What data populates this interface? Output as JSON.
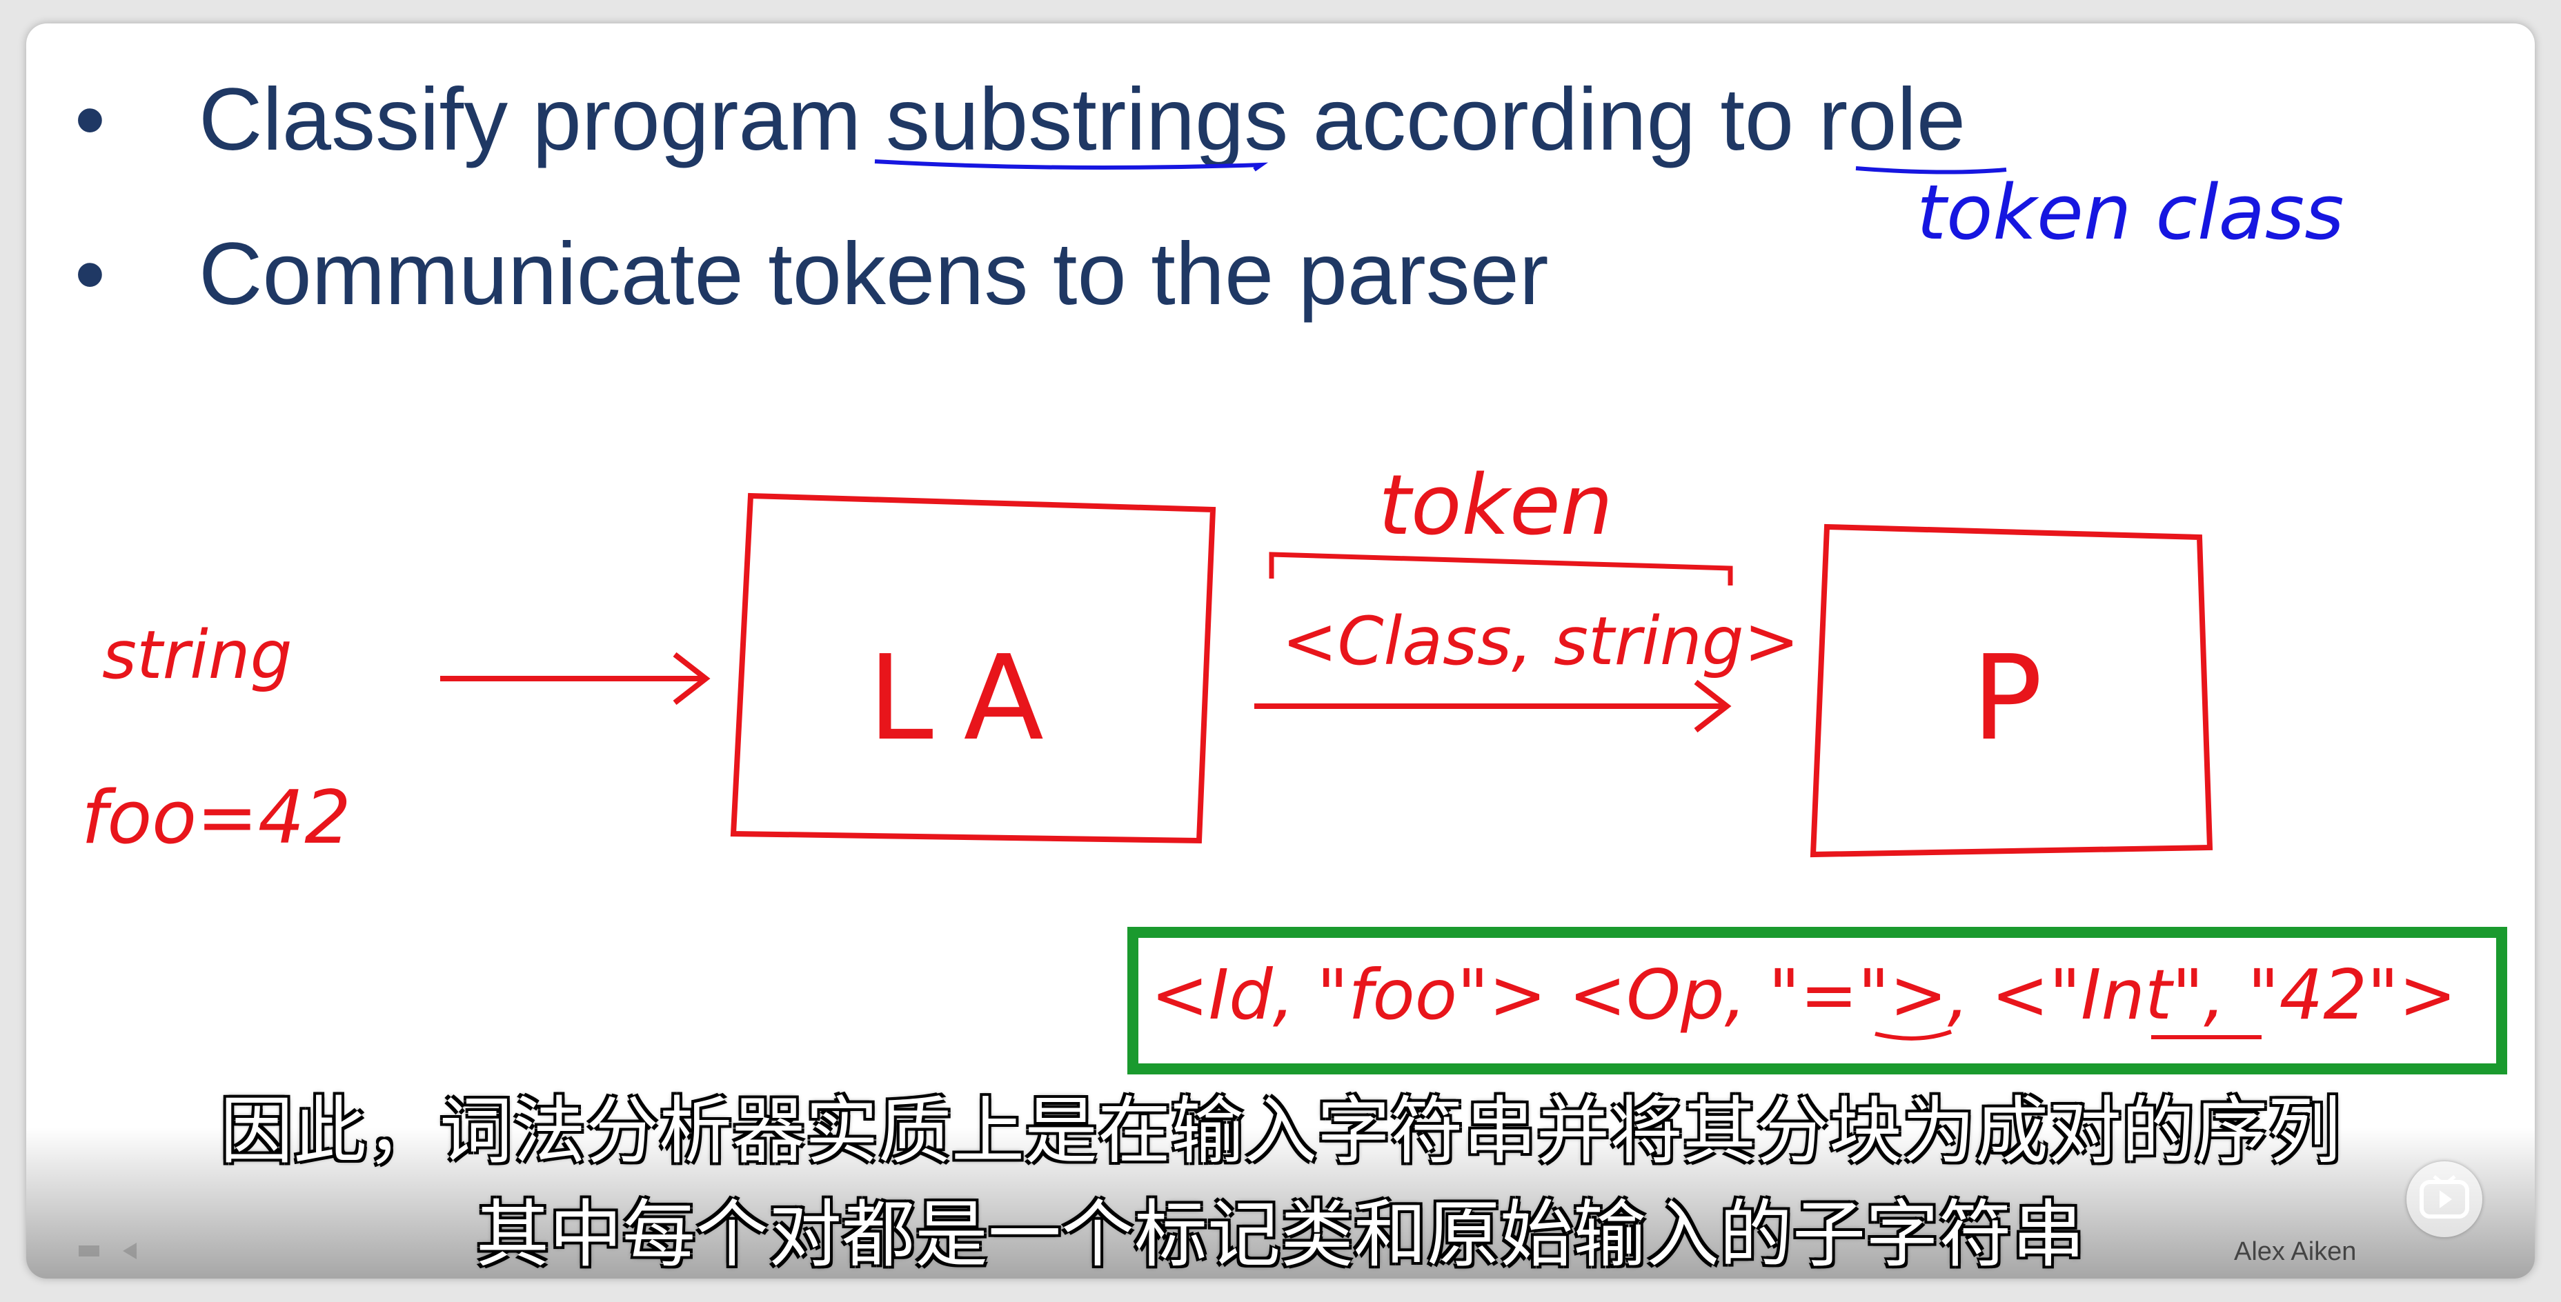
{
  "slide": {
    "bullets": [
      "Classify program substrings according to role",
      "Communicate tokens to the parser"
    ],
    "bullet_symbol": "•",
    "annotations": {
      "token_class": "token class",
      "string": "string",
      "input_example": "foo=42",
      "lexer_box": "LA",
      "token_label": "token",
      "token_format": "<Class, string>",
      "parser_box": "P",
      "token_sequence": "<Id, \"foo\">  <Op, \"=\">, <\"Int\", \"42\">"
    }
  },
  "subtitles": {
    "line1": "因此，词法分析器实质上是在输入字符串并将其分块为成对的序列",
    "line2": "其中每个对都是一个标记类和原始输入的子字符串"
  },
  "speaker": "Alex Aiken",
  "colors": {
    "slide_text": "#1f3864",
    "ink_red": "#e8151b",
    "ink_blue": "#1616e0",
    "highlight_green": "#1a9a2e"
  },
  "icons": {
    "play": "play-icon"
  }
}
